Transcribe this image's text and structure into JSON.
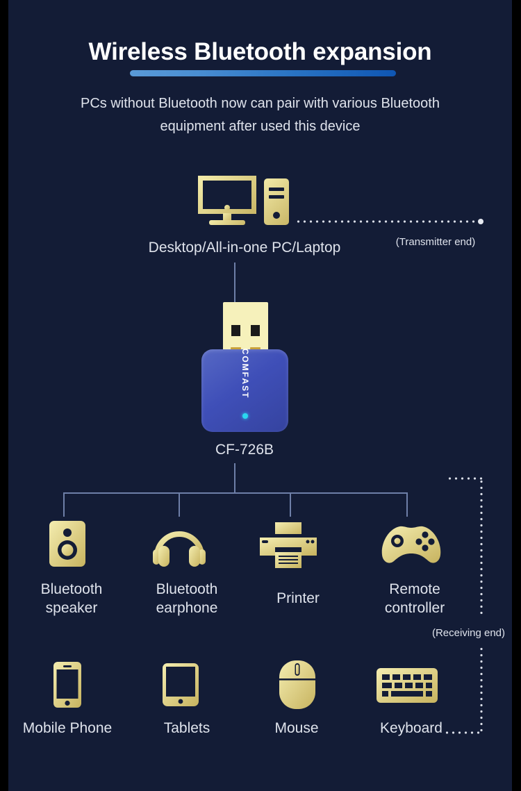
{
  "colors": {
    "background": "#131c36",
    "page_border": "#000000",
    "title_text": "#ffffff",
    "body_text": "#dfe3ec",
    "accent_bar_start": "#5a9ad8",
    "accent_bar_end": "#0f56b3",
    "icon_gold_light": "#f2eaa8",
    "icon_gold_dark": "#c9b767",
    "connector_line": "#6e7fa8",
    "dotted_line": "#d8dce6",
    "dongle_blue": "#3f4fb8",
    "usb_plug": "#f6f1bb",
    "led_cyan": "#2ad8f0"
  },
  "header": {
    "title": "Wireless Bluetooth expansion",
    "subtitle_line1": "PCs without Bluetooth now can pair with various Bluetooth",
    "subtitle_line2": "equipment after used this device"
  },
  "diagram": {
    "source": {
      "icon": "desktop-computer-icon",
      "label": "Desktop/All-in-one PC/Laptop",
      "end_label": "(Transmitter end)"
    },
    "device": {
      "icon": "usb-bluetooth-dongle-icon",
      "brand": "COMFAST",
      "model": "CF-726B",
      "led": "power-led-indicator"
    },
    "receiving_end_label": "(Receiving end)",
    "targets_row1": [
      {
        "icon": "bluetooth-speaker-icon",
        "label_line1": "Bluetooth",
        "label_line2": "speaker"
      },
      {
        "icon": "bluetooth-headphone-icon",
        "label_line1": "Bluetooth",
        "label_line2": "earphone"
      },
      {
        "icon": "printer-icon",
        "label_line1": "Printer",
        "label_line2": ""
      },
      {
        "icon": "game-controller-icon",
        "label_line1": "Remote",
        "label_line2": "controller"
      }
    ],
    "targets_row2": [
      {
        "icon": "mobile-phone-icon",
        "label_line1": "Mobile Phone",
        "label_line2": ""
      },
      {
        "icon": "tablet-icon",
        "label_line1": "Tablets",
        "label_line2": ""
      },
      {
        "icon": "mouse-icon",
        "label_line1": "Mouse",
        "label_line2": ""
      },
      {
        "icon": "keyboard-icon",
        "label_line1": "Keyboard",
        "label_line2": ""
      }
    ]
  }
}
